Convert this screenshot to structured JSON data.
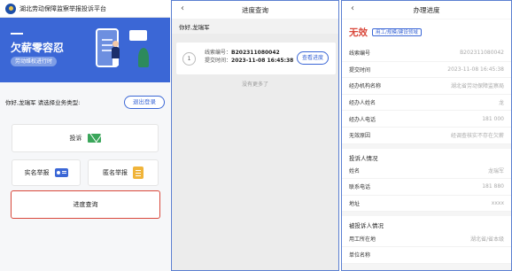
{
  "screen1": {
    "header_title": "湖北劳动保障监察举报投诉平台",
    "banner_headline": "欠薪零容忍",
    "banner_pill": "劳动维权进行时",
    "greeting": "你好,龙瑞军 请选择业务类型:",
    "logout_label": "退出登录",
    "complaint_label": "投诉",
    "named_report_label": "实名举报",
    "anon_report_label": "匿名举报",
    "progress_label": "进度查询"
  },
  "screen2": {
    "nav_title": "进度查询",
    "greeting": "你好,龙瑞军",
    "case_index": "1",
    "case_no_key": "线索编号：",
    "case_no_value": "B202311080042",
    "submit_key": "提交时间：",
    "submit_value": "2023-11-08 16:45:38",
    "query_label": "查看进度",
    "no_more": "没有更多了"
  },
  "screen3": {
    "nav_title": "办理进度",
    "status": "无效",
    "tag": "用工/规模/建设领域",
    "rows": [
      {
        "k": "线索编号",
        "v": "B202311080042"
      },
      {
        "k": "提交时间",
        "v": "2023-11-08 16:45:38"
      },
      {
        "k": "经办机构名称",
        "v": "湖北省劳动保障监察局"
      },
      {
        "k": "经办人姓名",
        "v": "龙"
      },
      {
        "k": "经办人电话",
        "v": "181 000"
      },
      {
        "k": "无效原因",
        "v": "经调查核实不存在欠薪"
      }
    ],
    "section_complainant": "投诉人情况",
    "complainant_rows": [
      {
        "k": "姓名",
        "v": "龙瑞军"
      },
      {
        "k": "联系电话",
        "v": "181 880"
      },
      {
        "k": "地址",
        "v": "xxxx"
      }
    ],
    "section_respondent": "被投诉人情况",
    "respondent_rows": [
      {
        "k": "用工所在地",
        "v": "湖北省/省本级"
      },
      {
        "k": "单位名称",
        "v": ""
      }
    ]
  }
}
